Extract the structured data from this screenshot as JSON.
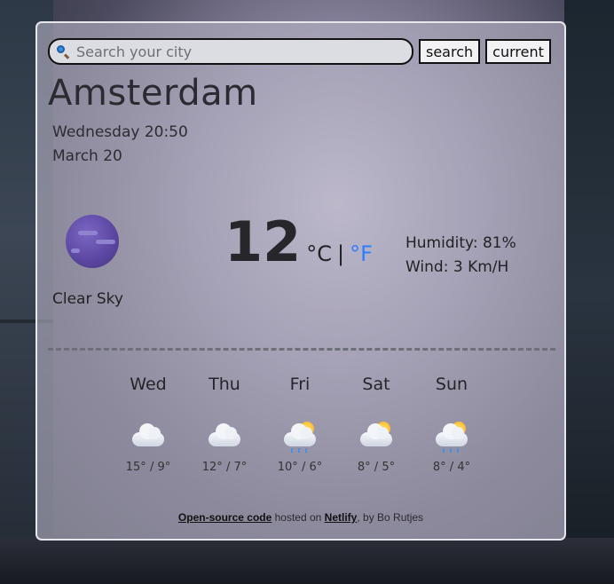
{
  "search": {
    "placeholder": "Search your city",
    "button_label": "search",
    "current_label": "current"
  },
  "city": "Amsterdam",
  "datetime": "Wednesday 20:50",
  "date": "March 20",
  "current": {
    "condition": "Clear Sky",
    "icon": "moon-icon",
    "temperature": "12",
    "unit_c": "°C",
    "unit_sep": "|",
    "unit_f": "°F",
    "humidity": "Humidity: 81%",
    "wind": "Wind: 3 Km/H"
  },
  "forecast": [
    {
      "day": "Wed",
      "temp": "15° / 9°",
      "icon": "cloud-icon"
    },
    {
      "day": "Thu",
      "temp": "12° / 7°",
      "icon": "cloud-icon"
    },
    {
      "day": "Fri",
      "temp": "10° / 6°",
      "icon": "sun-rain-cloud-icon"
    },
    {
      "day": "Sat",
      "temp": "8° / 5°",
      "icon": "sun-cloud-icon"
    },
    {
      "day": "Sun",
      "temp": "8° / 4°",
      "icon": "sun-rain-cloud-icon"
    }
  ],
  "footer": {
    "link1": "Open-source code",
    "text1": " hosted on ",
    "link2": "Netlify",
    "text2": ", by Bo Rutjes"
  },
  "colors": {
    "accent": "#2b7fff",
    "moon": "#5a46a0"
  }
}
